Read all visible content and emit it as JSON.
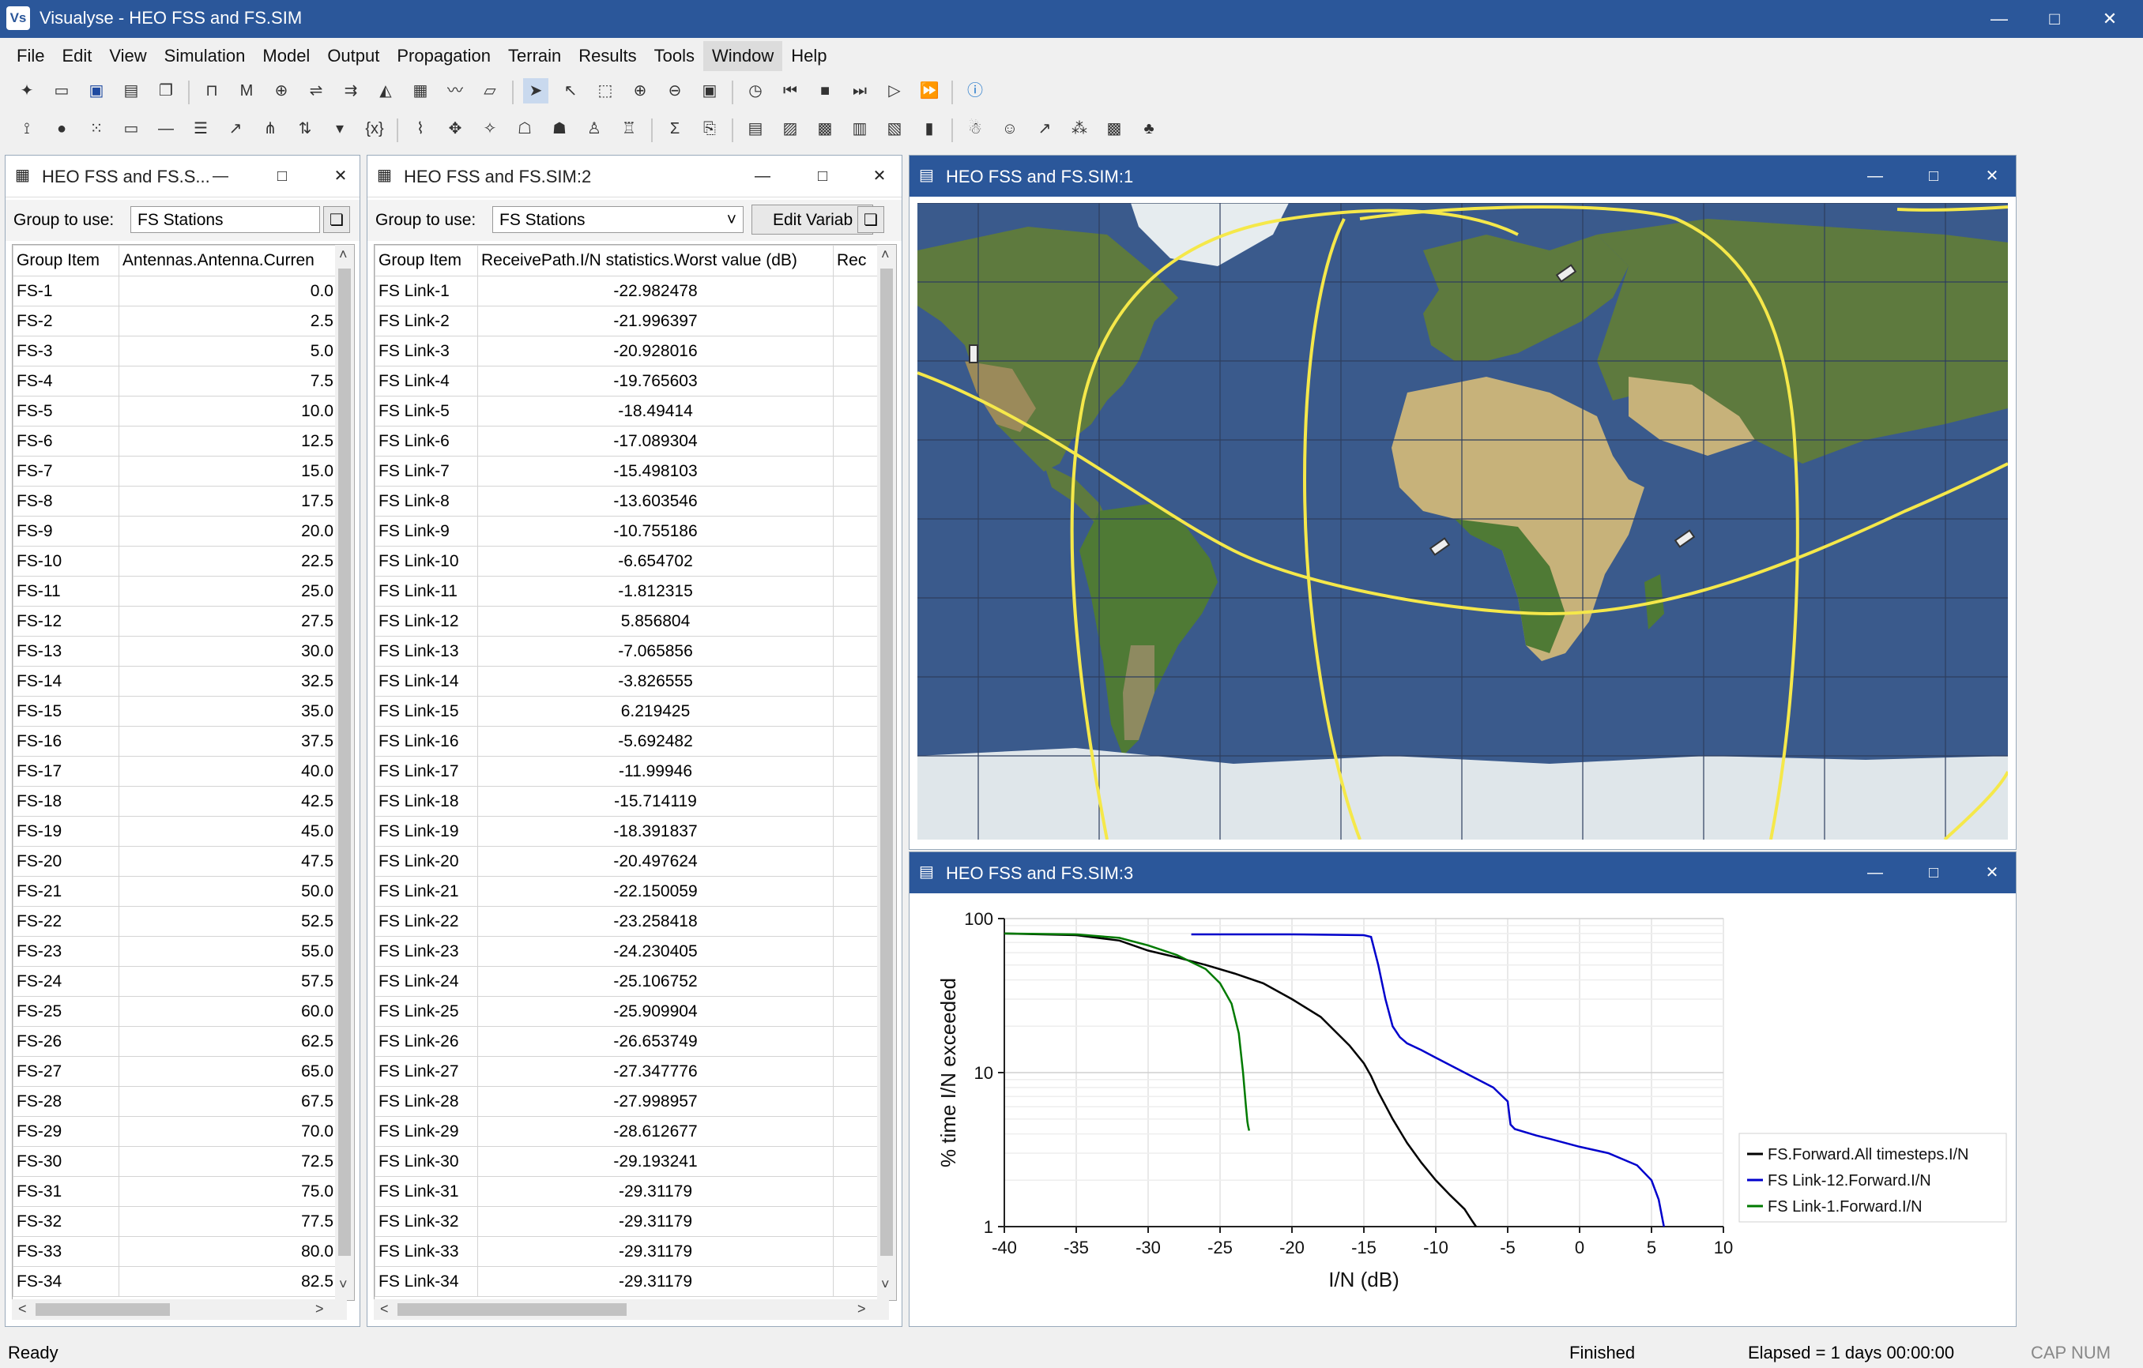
{
  "app": {
    "title": "Visualyse - HEO FSS and FS.SIM",
    "icon_text": "Vs",
    "minimize_icon": "minimize-icon",
    "maximize_icon": "maximize-icon",
    "close_icon": "close-icon"
  },
  "menu": [
    "File",
    "Edit",
    "View",
    "Simulation",
    "Model",
    "Output",
    "Propagation",
    "Terrain",
    "Results",
    "Tools",
    "Window",
    "Help"
  ],
  "toolbar1": [
    "new-icon",
    "open-icon",
    "save-icon",
    "save-as-icon",
    "copy-icon",
    "station-icon",
    "mobile-icon",
    "earth-station-icon",
    "link-icon",
    "group-link-icon",
    "terrain-icon",
    "table-icon",
    "plot-icon",
    "area-icon",
    "select-icon",
    "select-link-icon",
    "select-area-icon",
    "zoom-in-icon",
    "zoom-out-icon",
    "zoom-100-icon",
    "clock-icon",
    "skip-back-icon",
    "stop-icon",
    "step-icon",
    "play-icon",
    "fast-forward-icon",
    "info-icon"
  ],
  "toolbar2": [
    "antenna-icon",
    "dot-icon",
    "grid-icon",
    "rectangle-icon",
    "line-icon",
    "list-icon",
    "beam-icon",
    "network-icon",
    "swap-icon",
    "dropdown-icon",
    "variable-icon",
    "chain-icon",
    "fan-icon",
    "fan2-icon",
    "people-icon",
    "people2-icon",
    "people3-icon",
    "people4-icon",
    "sigma-icon",
    "export-icon",
    "caption-icon",
    "map-select-icon",
    "map-add-icon",
    "map-icon",
    "chart-icon",
    "bar-chart-icon",
    "user-icon",
    "user-add-icon",
    "arrow-icon",
    "scatter-icon",
    "qr-icon",
    "tree-icon"
  ],
  "windows": {
    "stations": {
      "title": "HEO FSS and FS.S...",
      "group_label": "Group to use:",
      "group_value": "FS Stations",
      "columns": [
        "Group Item",
        "Antennas.Antenna.Curren"
      ],
      "rows": [
        [
          "FS-1",
          "0.0"
        ],
        [
          "FS-2",
          "2.5"
        ],
        [
          "FS-3",
          "5.0"
        ],
        [
          "FS-4",
          "7.5"
        ],
        [
          "FS-5",
          "10.0"
        ],
        [
          "FS-6",
          "12.5"
        ],
        [
          "FS-7",
          "15.0"
        ],
        [
          "FS-8",
          "17.5"
        ],
        [
          "FS-9",
          "20.0"
        ],
        [
          "FS-10",
          "22.5"
        ],
        [
          "FS-11",
          "25.0"
        ],
        [
          "FS-12",
          "27.5"
        ],
        [
          "FS-13",
          "30.0"
        ],
        [
          "FS-14",
          "32.5"
        ],
        [
          "FS-15",
          "35.0"
        ],
        [
          "FS-16",
          "37.5"
        ],
        [
          "FS-17",
          "40.0"
        ],
        [
          "FS-18",
          "42.5"
        ],
        [
          "FS-19",
          "45.0"
        ],
        [
          "FS-20",
          "47.5"
        ],
        [
          "FS-21",
          "50.0"
        ],
        [
          "FS-22",
          "52.5"
        ],
        [
          "FS-23",
          "55.0"
        ],
        [
          "FS-24",
          "57.5"
        ],
        [
          "FS-25",
          "60.0"
        ],
        [
          "FS-26",
          "62.5"
        ],
        [
          "FS-27",
          "65.0"
        ],
        [
          "FS-28",
          "67.5"
        ],
        [
          "FS-29",
          "70.0"
        ],
        [
          "FS-30",
          "72.5"
        ],
        [
          "FS-31",
          "75.0"
        ],
        [
          "FS-32",
          "77.5"
        ],
        [
          "FS-33",
          "80.0"
        ],
        [
          "FS-34",
          "82.5"
        ]
      ]
    },
    "links": {
      "title": "HEO FSS and FS.SIM:2",
      "group_label": "Group to use:",
      "group_value": "FS Stations",
      "edit_button": "Edit Variab",
      "columns": [
        "Group Item",
        "ReceivePath.I/N statistics.Worst value (dB)",
        "Rec"
      ],
      "rows": [
        [
          "FS Link-1",
          "-22.982478"
        ],
        [
          "FS Link-2",
          "-21.996397"
        ],
        [
          "FS Link-3",
          "-20.928016"
        ],
        [
          "FS Link-4",
          "-19.765603"
        ],
        [
          "FS Link-5",
          "-18.49414"
        ],
        [
          "FS Link-6",
          "-17.089304"
        ],
        [
          "FS Link-7",
          "-15.498103"
        ],
        [
          "FS Link-8",
          "-13.603546"
        ],
        [
          "FS Link-9",
          "-10.755186"
        ],
        [
          "FS Link-10",
          "-6.654702"
        ],
        [
          "FS Link-11",
          "-1.812315"
        ],
        [
          "FS Link-12",
          "5.856804"
        ],
        [
          "FS Link-13",
          "-7.065856"
        ],
        [
          "FS Link-14",
          "-3.826555"
        ],
        [
          "FS Link-15",
          "6.219425"
        ],
        [
          "FS Link-16",
          "-5.692482"
        ],
        [
          "FS Link-17",
          "-11.99946"
        ],
        [
          "FS Link-18",
          "-15.714119"
        ],
        [
          "FS Link-19",
          "-18.391837"
        ],
        [
          "FS Link-20",
          "-20.497624"
        ],
        [
          "FS Link-21",
          "-22.150059"
        ],
        [
          "FS Link-22",
          "-23.258418"
        ],
        [
          "FS Link-23",
          "-24.230405"
        ],
        [
          "FS Link-24",
          "-25.106752"
        ],
        [
          "FS Link-25",
          "-25.909904"
        ],
        [
          "FS Link-26",
          "-26.653749"
        ],
        [
          "FS Link-27",
          "-27.347776"
        ],
        [
          "FS Link-28",
          "-27.998957"
        ],
        [
          "FS Link-29",
          "-28.612677"
        ],
        [
          "FS Link-30",
          "-29.193241"
        ],
        [
          "FS Link-31",
          "-29.31179"
        ],
        [
          "FS Link-32",
          "-29.31179"
        ],
        [
          "FS Link-33",
          "-29.31179"
        ],
        [
          "FS Link-34",
          "-29.31179"
        ]
      ]
    },
    "map": {
      "title": "HEO FSS and FS.SIM:1"
    },
    "plot": {
      "title": "HEO FSS and FS.SIM:3"
    }
  },
  "chart_data": {
    "type": "line",
    "title": "",
    "xlabel": "I/N (dB)",
    "ylabel": "% time I/N exceeded",
    "xlim": [
      -40,
      10
    ],
    "ylim": [
      1,
      100
    ],
    "y_scale": "log",
    "x_ticks": [
      -40,
      -35,
      -30,
      -25,
      -20,
      -15,
      -10,
      -5,
      0,
      5,
      10
    ],
    "x_tick_labels": [
      "-40",
      "-35",
      "-30",
      "-25",
      "-20",
      "-15",
      "-10",
      "-5",
      "0",
      "5",
      "10"
    ],
    "y_ticks": [
      1,
      10,
      100
    ],
    "y_tick_labels": [
      "1",
      "10",
      "100"
    ],
    "grid": true,
    "legend_position": "right",
    "series": [
      {
        "name": "FS.Forward.All timesteps.I/N",
        "color": "#000000",
        "x": [
          -40,
          -35,
          -32,
          -30,
          -28,
          -26,
          -24,
          -22,
          -20,
          -18,
          -16,
          -15,
          -14.5,
          -14,
          -13,
          -12,
          -11,
          -10,
          -9,
          -8,
          -7.5,
          -7.2
        ],
        "y": [
          80,
          78,
          72,
          62,
          56,
          50,
          44,
          38,
          30,
          23,
          15,
          11.5,
          9.5,
          7.5,
          5,
          3.5,
          2.6,
          2,
          1.6,
          1.3,
          1.1,
          1
        ]
      },
      {
        "name": "FS Link-12.Forward.I/N",
        "color": "#0000cc",
        "x": [
          -27,
          -20,
          -15,
          -14.5,
          -14,
          -13.5,
          -13,
          -12.5,
          -12,
          -11,
          -10,
          -8,
          -6,
          -5,
          -4.8,
          -4.5,
          -3,
          -2,
          0,
          2,
          4,
          5,
          5.5,
          5.86
        ],
        "y": [
          79,
          79,
          78,
          76,
          50,
          30,
          20,
          17,
          15.5,
          14,
          12.5,
          10,
          8,
          6.5,
          4.6,
          4.3,
          3.9,
          3.7,
          3.3,
          3,
          2.5,
          2,
          1.5,
          1
        ]
      },
      {
        "name": "FS Link-1.Forward.I/N",
        "color": "#007a00",
        "x": [
          -40,
          -35,
          -32,
          -30,
          -28,
          -26,
          -25,
          -24.2,
          -23.7,
          -23.4,
          -23.2,
          -23.1,
          -23.05,
          -22.98
        ],
        "y": [
          80,
          79,
          75,
          67,
          58,
          47,
          38,
          28,
          18,
          10,
          6,
          4.8,
          4.5,
          4.2
        ]
      }
    ]
  },
  "status": {
    "left": "Ready",
    "middle": "Finished",
    "elapsed": "Elapsed = 1 days 00:00:00",
    "caps": "CAP NUM"
  }
}
